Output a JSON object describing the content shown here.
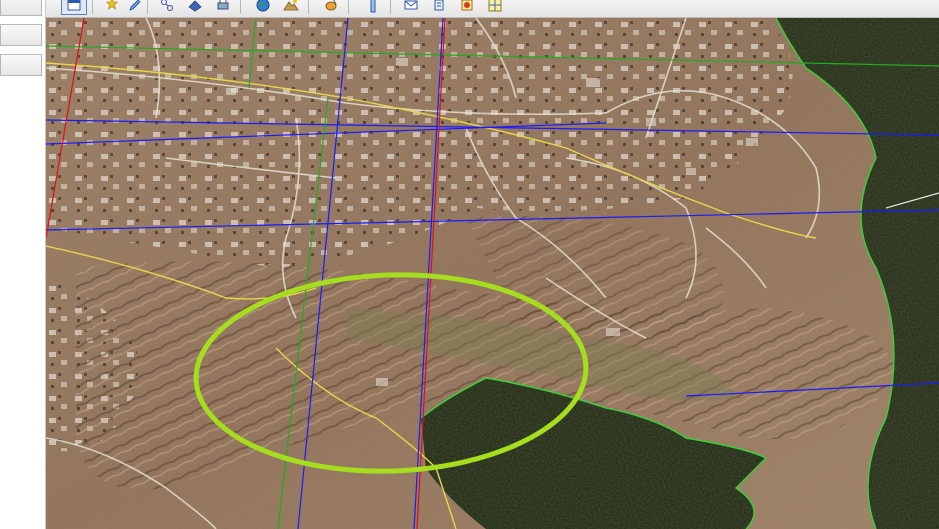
{
  "app": {
    "left_panel": {
      "rows": 3
    },
    "toolbar": {
      "buttons": [
        {
          "name": "layers-panel-icon"
        },
        {
          "name": "wand-icon"
        },
        {
          "name": "pencil-icon"
        },
        {
          "name": "node-edit-icon"
        },
        {
          "name": "fill-icon"
        },
        {
          "name": "print-icon"
        },
        {
          "name": "globe-icon"
        },
        {
          "name": "terrain-icon"
        },
        {
          "name": "paint-icon"
        },
        {
          "name": "ruler-icon"
        },
        {
          "name": "mail-icon"
        },
        {
          "name": "export-icon"
        },
        {
          "name": "sync-icon"
        },
        {
          "name": "grid-map-icon"
        }
      ]
    },
    "map": {
      "type": "satellite-imagery",
      "overlay_colors": {
        "gridlines_blue": "#1a1aff",
        "gridlines_red": "#e01010",
        "gridlines_green": "#22aa22",
        "road_yellow": "#e8d64a",
        "forest_boundary": "#33cc33",
        "highlight_ellipse": "#a6dd1f"
      }
    }
  }
}
